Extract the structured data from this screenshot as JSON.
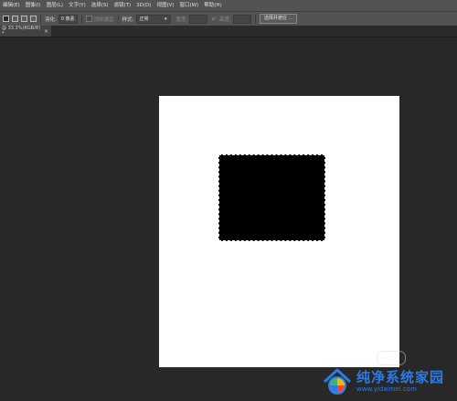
{
  "menu": {
    "items": [
      "编辑(E)",
      "图像(I)",
      "图层(L)",
      "文字(Y)",
      "选择(S)",
      "滤镜(T)",
      "3D(D)",
      "视图(V)",
      "窗口(W)",
      "帮助(H)"
    ]
  },
  "options": {
    "feather_label": "羽化:",
    "feather_value": "0 像素",
    "antialias_label": "消除锯齿",
    "style_label": "样式:",
    "style_value": "正常",
    "width_label": "宽度:",
    "height_label": "高度:",
    "select_and_mask_label": "选择并遮住 ..."
  },
  "tab": {
    "title": "@ 33.3%(RGB/8) *",
    "close_glyph": "×"
  },
  "watermark": {
    "title": "纯净系统家园",
    "url": "www.yidaimei.com"
  },
  "colors": {
    "accent": "#2c7be5",
    "panel": "#535353",
    "workspace": "#282828"
  }
}
